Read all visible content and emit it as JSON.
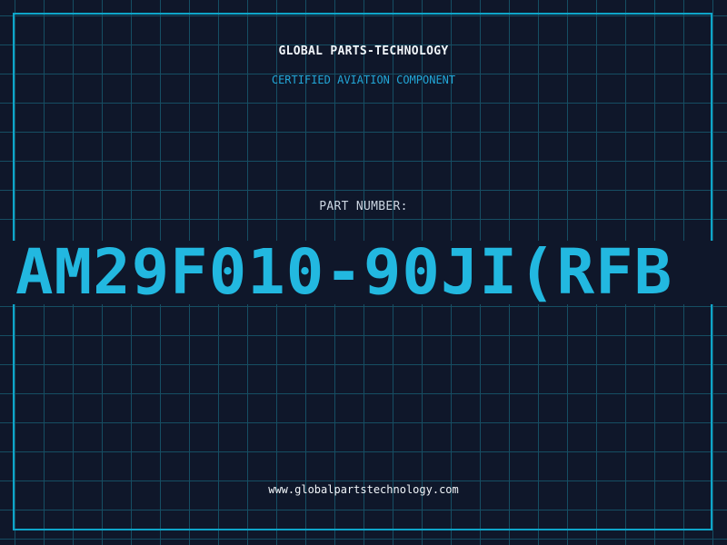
{
  "header": {
    "company": "GLOBAL PARTS-TECHNOLOGY",
    "tagline": "CERTIFIED AVIATION COMPONENT"
  },
  "part": {
    "label": "PART NUMBER:",
    "number": "AM29F010-90JI(RFB"
  },
  "footer": {
    "website": "www.globalpartstechnology.com"
  },
  "colors": {
    "background": "#0f172a",
    "grid": "#164e63",
    "accent": "#22b8e0",
    "frame": "#0ea5c9",
    "text": "#f1f5f9"
  }
}
